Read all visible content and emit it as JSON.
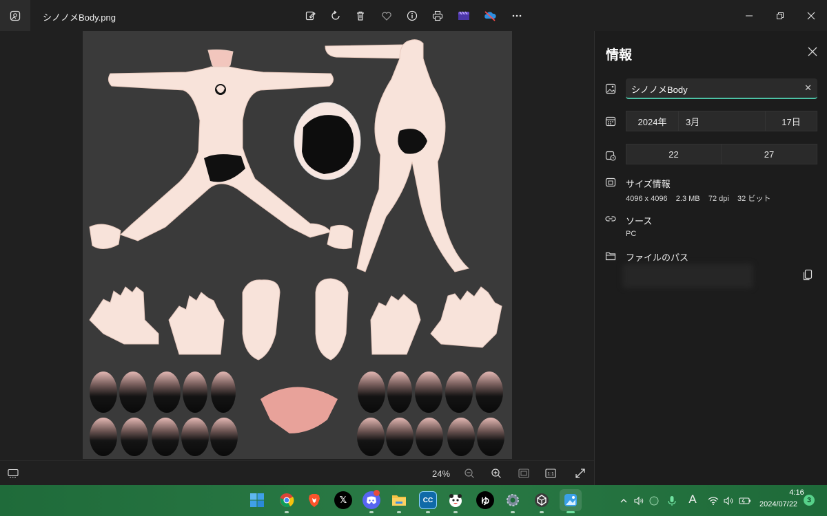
{
  "window": {
    "title": "シノノメBody.png"
  },
  "toolbar": {
    "icons": [
      "edit-icon",
      "rotate-icon",
      "delete-icon",
      "favorite-icon",
      "info-icon",
      "print-icon",
      "clipchamp-icon",
      "onedrive-icon",
      "more-icon"
    ]
  },
  "bottom_bar": {
    "zoom": "24%"
  },
  "info_panel": {
    "title": "情報",
    "file_name": "シノノメBody",
    "date": {
      "year": "2024年",
      "month": "3月",
      "day": "17日"
    },
    "time": {
      "hour": "22",
      "minute": "27"
    },
    "size_label": "サイズ情報",
    "size_value": "4096 x 4096    2.3 MB    72 dpi    32 ビット",
    "source_label": "ソース",
    "source_value": "PC",
    "path_label": "ファイルのパス"
  },
  "taskbar": {
    "time": "4:16",
    "date": "2024/07/22",
    "notification_count": "3",
    "ime_indicator": "A",
    "apps": [
      "start",
      "chrome",
      "brave",
      "x",
      "discord",
      "file-explorer",
      "cc",
      "app-panda",
      "yu",
      "settings",
      "unity",
      "photos"
    ],
    "icon_labels": {
      "x": "𝕏",
      "cc": "CC",
      "yu": "ゆ"
    }
  },
  "colors": {
    "accent": "#4cc2a5",
    "taskbar": "#1f6b3a",
    "canvas": "#3a3a3a",
    "skin": "#f7e2d8"
  }
}
